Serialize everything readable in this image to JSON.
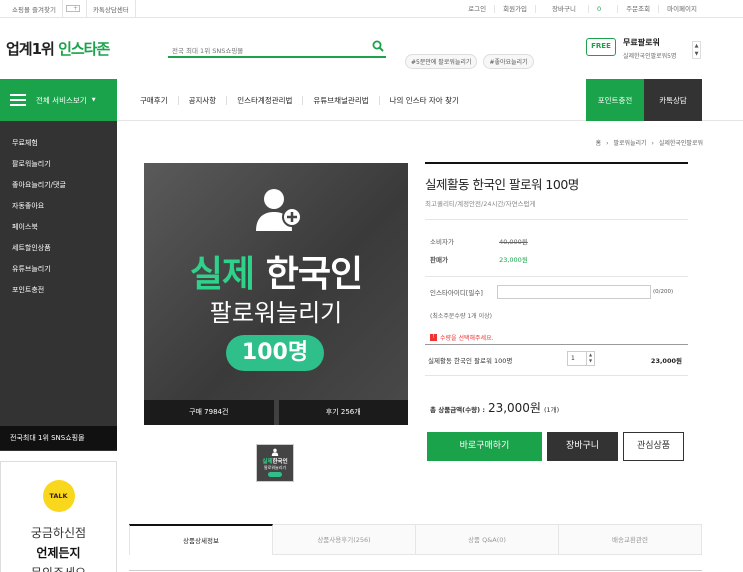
{
  "topbar": {
    "bookmark": "쇼핑몰 즐겨찾기",
    "kakao_center": "카톡상담센터",
    "links": {
      "login": "로그인",
      "join": "회원가입",
      "cart": "장바구니",
      "cart_count": "0",
      "orders": "주문조회",
      "mypage": "마이페이지"
    }
  },
  "header": {
    "logo_dark": "업계1위",
    "logo_green": "인스타존",
    "search_placeholder": "전국 최대 1위 SNS쇼핑몰",
    "tags": [
      "#5분만에 팔로워늘리기",
      "#좋아요늘리기"
    ],
    "free_badge": "FREE",
    "free_title": "무료팔로워",
    "free_sub": "실제한국인팔로워5명"
  },
  "nav": {
    "all_services": "전체 서비스보기",
    "menu": [
      "구매후기",
      "공지사항",
      "인스타계정관리법",
      "유튜브채널관리법",
      "나의 인스타 자아 찾기"
    ],
    "point_button": "포인트충전",
    "kakao_button": "카톡상담"
  },
  "sidebar": {
    "items": [
      "무료체험",
      "팔로워늘리기",
      "좋아요늘리기/댓글",
      "자동좋아요",
      "페이스북",
      "세트할인상품",
      "유튜브늘리기",
      "포인트충전"
    ],
    "bottom": "전국최대 1위 SNS쇼핑몰",
    "talk_icon": "TALK",
    "talk_line1": "궁금하신점",
    "talk_line2": "언제든지",
    "talk_line3": "문의주세요"
  },
  "breadcrumb": [
    "홈",
    "팔로워늘리기",
    "실제한국인팔로워"
  ],
  "product_image": {
    "line1_green": "실제",
    "line1_white": "한국인",
    "line2": "팔로워늘리기",
    "pill": "100명",
    "buy_count": "구매 7984건",
    "review_count": "후기 256개",
    "thumb_green": "실제",
    "thumb_white": "한국인",
    "thumb_sub": "팔로워늘리기"
  },
  "product": {
    "title": "실제활동 한국인 팔로워 100명",
    "desc": "최고퀄리티/계정안전/24시간/자연스럽게",
    "consumer_label": "소비자가",
    "consumer_price": "40,000원",
    "sale_label": "판매가",
    "sale_price": "23,000원",
    "id_label": "인스타아이디[필수]",
    "id_count": "(0/200)",
    "min_order": "(최소주문수량 1개 이상)",
    "warning": "수량을 선택해주세요.",
    "option_name": "실제활동 한국인 팔로워 100명",
    "quantity": "1",
    "option_price": "23,000원",
    "total_label": "총 상품금액(수량) :",
    "total_value": "23,000원",
    "total_count": "(1개)",
    "buy_button": "바로구매하기",
    "cart_button": "장바구니",
    "wish_button": "관심상품"
  },
  "detail_tabs": [
    "상품상세정보",
    "상품사용후기(256)",
    "상품 Q&A(0)",
    "배송교환관련"
  ]
}
